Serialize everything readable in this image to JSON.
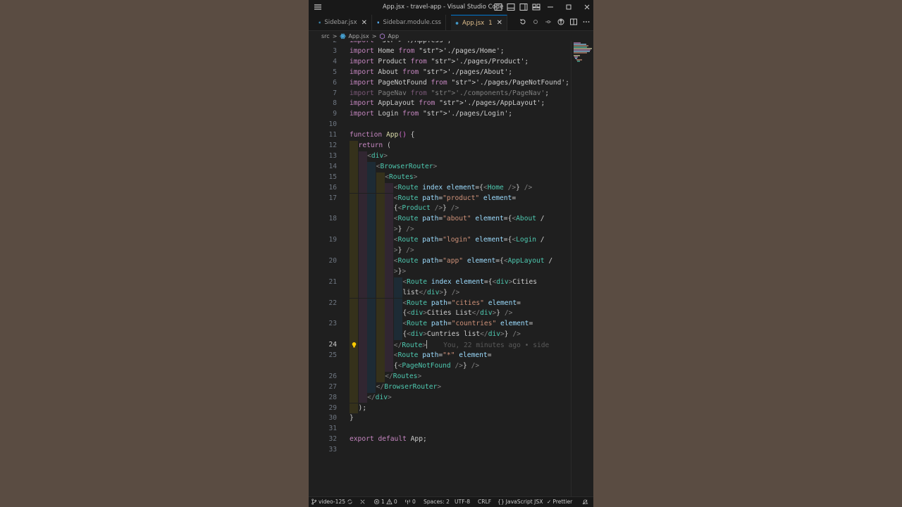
{
  "window": {
    "title": "App.jsx - travel-app - Visual Studio Code"
  },
  "tabs": [
    {
      "label": "Sidebar.jsx",
      "icon": "react-icon",
      "active": false
    },
    {
      "label": "Sidebar.module.css",
      "icon": "css-icon",
      "active": false
    },
    {
      "label": "App.jsx",
      "icon": "react-icon",
      "active": true,
      "problems": "1"
    }
  ],
  "breadcrumb": {
    "folder": "src",
    "sep": ">",
    "file": "App.jsx",
    "symbol": "App"
  },
  "editor": {
    "current_line": "24",
    "blame": "You, 22 minutes ago • side",
    "lines": [
      {
        "n": "2",
        "text": "import './App.css';"
      },
      {
        "n": "3",
        "text": "import Home from './pages/Home';"
      },
      {
        "n": "4",
        "text": "import Product from './pages/Product';"
      },
      {
        "n": "5",
        "text": "import About from './pages/About';"
      },
      {
        "n": "6",
        "text": "import PageNotFound from './pages/PageNotFound';"
      },
      {
        "n": "7",
        "text": "import PageNav from './components/PageNav';"
      },
      {
        "n": "8",
        "text": "import AppLayout from './pages/AppLayout';"
      },
      {
        "n": "9",
        "text": "import Login from './pages/Login';"
      },
      {
        "n": "10",
        "text": ""
      },
      {
        "n": "11",
        "text": "function App() {"
      },
      {
        "n": "12",
        "text": "return ("
      },
      {
        "n": "13",
        "text": "<div>"
      },
      {
        "n": "14",
        "text": "<BrowserRouter>"
      },
      {
        "n": "15",
        "text": "<Routes>"
      },
      {
        "n": "16",
        "text": "<Route index element={<Home />} />"
      },
      {
        "n": "17",
        "text": "<Route path=\"product\" element="
      },
      {
        "n": "",
        "text": "{<Product />} />"
      },
      {
        "n": "18",
        "text": "<Route path=\"about\" element={<About /"
      },
      {
        "n": "",
        "text": ">} />"
      },
      {
        "n": "19",
        "text": "<Route path=\"login\" element={<Login /"
      },
      {
        "n": "",
        "text": ">} />"
      },
      {
        "n": "20",
        "text": "<Route path=\"app\" element={<AppLayout /"
      },
      {
        "n": "",
        "text": ">}>"
      },
      {
        "n": "21",
        "text": "<Route index element={<div>Cities"
      },
      {
        "n": "",
        "text": "list</div>} />"
      },
      {
        "n": "22",
        "text": "<Route path=\"cities\" element="
      },
      {
        "n": "",
        "text": "{<div>Cities List</div>} />"
      },
      {
        "n": "23",
        "text": "<Route path=\"countries\" element="
      },
      {
        "n": "",
        "text": "{<div>Cuntries list</div>} />"
      },
      {
        "n": "24",
        "text": "</Route>"
      },
      {
        "n": "25",
        "text": "<Route path=\"*\" element="
      },
      {
        "n": "",
        "text": "{<PageNotFound />} />"
      },
      {
        "n": "26",
        "text": "</Routes>"
      },
      {
        "n": "27",
        "text": "</BrowserRouter>"
      },
      {
        "n": "28",
        "text": "</div>"
      },
      {
        "n": "29",
        "text": ");"
      },
      {
        "n": "30",
        "text": "}"
      },
      {
        "n": "31",
        "text": ""
      },
      {
        "n": "32",
        "text": "export default App;"
      },
      {
        "n": "33",
        "text": ""
      }
    ]
  },
  "statusbar": {
    "branch": "video-125",
    "errors": "1",
    "warnings": "0",
    "ports": "0",
    "spaces": "Spaces: 2",
    "encoding": "UTF-8",
    "eol": "CRLF",
    "language": "JavaScript JSX",
    "formatter": "Prettier"
  }
}
